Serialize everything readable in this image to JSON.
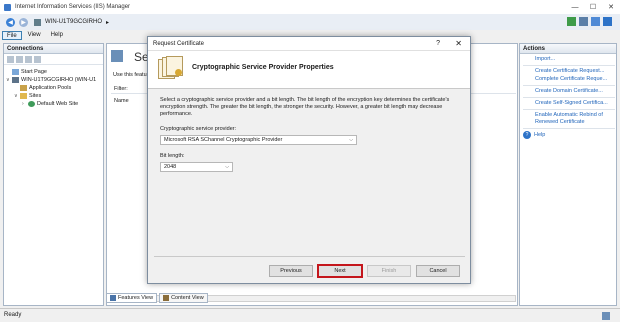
{
  "window": {
    "title": "Internet Information Services (IIS) Manager",
    "controls": [
      "—",
      "☐",
      "✕"
    ]
  },
  "address": {
    "path": "WIN-U1T9GCGIRHO",
    "separator": "▸"
  },
  "menu": {
    "items": [
      "File",
      "View",
      "Help"
    ]
  },
  "connections": {
    "title": "Connections",
    "tree": [
      {
        "label": "Start Page",
        "icon": "start-page-icon",
        "expander": ""
      },
      {
        "label": "WIN-U1T9GCGIRHO (WIN-U1",
        "icon": "server-icon",
        "expander": "∨"
      },
      {
        "label": "Application Pools",
        "icon": "application-pools-icon",
        "expander": ""
      },
      {
        "label": "Sites",
        "icon": "sites-folder-icon",
        "expander": "∨"
      },
      {
        "label": "Default Web Site",
        "icon": "globe-icon",
        "expander": "›"
      }
    ]
  },
  "center": {
    "heading": "Serv",
    "description": "Use this featu",
    "filter_label": "Filter:",
    "column_name": "Name"
  },
  "view_tabs": {
    "features": "Features View",
    "content": "Content View"
  },
  "actions": {
    "title": "Actions",
    "links": [
      "Import...",
      "Create Certificate Request...",
      "Complete Certificate Reque...",
      "Create Domain Certificate...",
      "Create Self-Signed Certifica...",
      "Enable Automatic Rebind of Renewed Certificate"
    ],
    "help": "Help"
  },
  "status": {
    "text": "Ready"
  },
  "dialog": {
    "title": "Request Certificate",
    "help_glyph": "?",
    "close_glyph": "✕",
    "heading": "Cryptographic Service Provider Properties",
    "description": "Select a cryptographic service provider and a bit length. The bit length of the encryption key determines the certificate's encryption strength. The greater the bit length, the stronger the security. However, a greater bit length may decrease performance.",
    "provider_label": "Cryptographic service provider:",
    "provider_value": "Microsoft RSA SChannel Cryptographic Provider",
    "bitlength_label": "Bit length:",
    "bitlength_value": "2048",
    "buttons": {
      "previous": "Previous",
      "next": "Next",
      "finish": "Finish",
      "cancel": "Cancel"
    },
    "next_highlight_color": "#c4161c"
  }
}
